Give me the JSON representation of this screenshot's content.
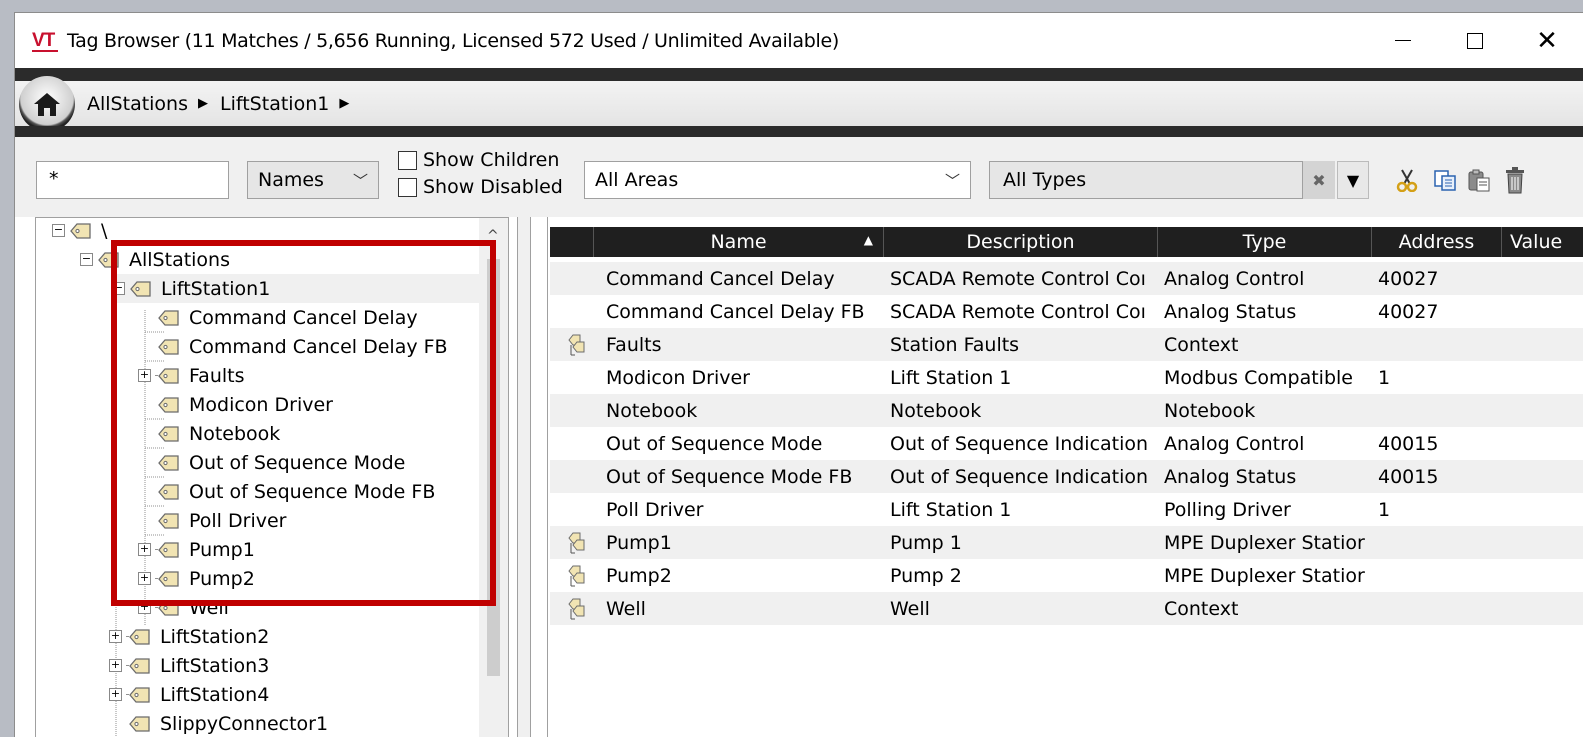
{
  "window": {
    "logo_text": "VT",
    "title": "Tag Browser (11 Matches / 5,656 Running, Licensed 572 Used / Unlimited Available)"
  },
  "breadcrumb": {
    "items": [
      "AllStations",
      "LiftStation1"
    ]
  },
  "toolbar": {
    "filter_value": "*",
    "mode_select": "Names",
    "show_children_label": "Show Children",
    "show_disabled_label": "Show Disabled",
    "areas_select": "All Areas",
    "types_select": "All Types",
    "clear_glyph": "✖",
    "filter_glyph": "▼"
  },
  "tree": {
    "items": [
      {
        "label": "\\"
      },
      {
        "label": "AllStations"
      },
      {
        "label": "LiftStation1"
      },
      {
        "label": "Command Cancel Delay"
      },
      {
        "label": "Command Cancel Delay FB"
      },
      {
        "label": "Faults"
      },
      {
        "label": "Modicon Driver"
      },
      {
        "label": "Notebook"
      },
      {
        "label": "Out of Sequence Mode"
      },
      {
        "label": "Out of Sequence Mode FB"
      },
      {
        "label": "Poll Driver"
      },
      {
        "label": "Pump1"
      },
      {
        "label": "Pump2"
      },
      {
        "label": "Well"
      },
      {
        "label": "LiftStation2"
      },
      {
        "label": "LiftStation3"
      },
      {
        "label": "LiftStation4"
      },
      {
        "label": "SlippyConnector1"
      }
    ]
  },
  "grid": {
    "columns": [
      "Name",
      "Description",
      "Type",
      "Address",
      "Value"
    ],
    "rows": [
      {
        "name": "Command Cancel Delay",
        "description": "SCADA Remote Control Coı",
        "type": "Analog Control",
        "address": "40027",
        "value": ""
      },
      {
        "name": "Command Cancel Delay FB",
        "description": "SCADA Remote Control Coı",
        "type": "Analog Status",
        "address": "40027",
        "value": ""
      },
      {
        "name": "Faults",
        "description": "Station Faults",
        "type": "Context",
        "address": "",
        "value": ""
      },
      {
        "name": "Modicon Driver",
        "description": "Lift Station 1",
        "type": "Modbus Compatible",
        "address": "1",
        "value": ""
      },
      {
        "name": "Notebook",
        "description": "Notebook",
        "type": "Notebook",
        "address": "",
        "value": ""
      },
      {
        "name": "Out of Sequence Mode",
        "description": "Out of Sequence Indication",
        "type": "Analog Control",
        "address": "40015",
        "value": ""
      },
      {
        "name": "Out of Sequence Mode FB",
        "description": "Out of Sequence Indication",
        "type": "Analog Status",
        "address": "40015",
        "value": ""
      },
      {
        "name": "Poll Driver",
        "description": "Lift Station 1",
        "type": "Polling Driver",
        "address": "1",
        "value": ""
      },
      {
        "name": "Pump1",
        "description": "Pump 1",
        "type": "MPE Duplexer Statior",
        "address": "",
        "value": ""
      },
      {
        "name": "Pump2",
        "description": "Pump 2",
        "type": "MPE Duplexer Statior",
        "address": "",
        "value": ""
      },
      {
        "name": "Well",
        "description": "Well",
        "type": "Context",
        "address": "",
        "value": ""
      }
    ]
  }
}
